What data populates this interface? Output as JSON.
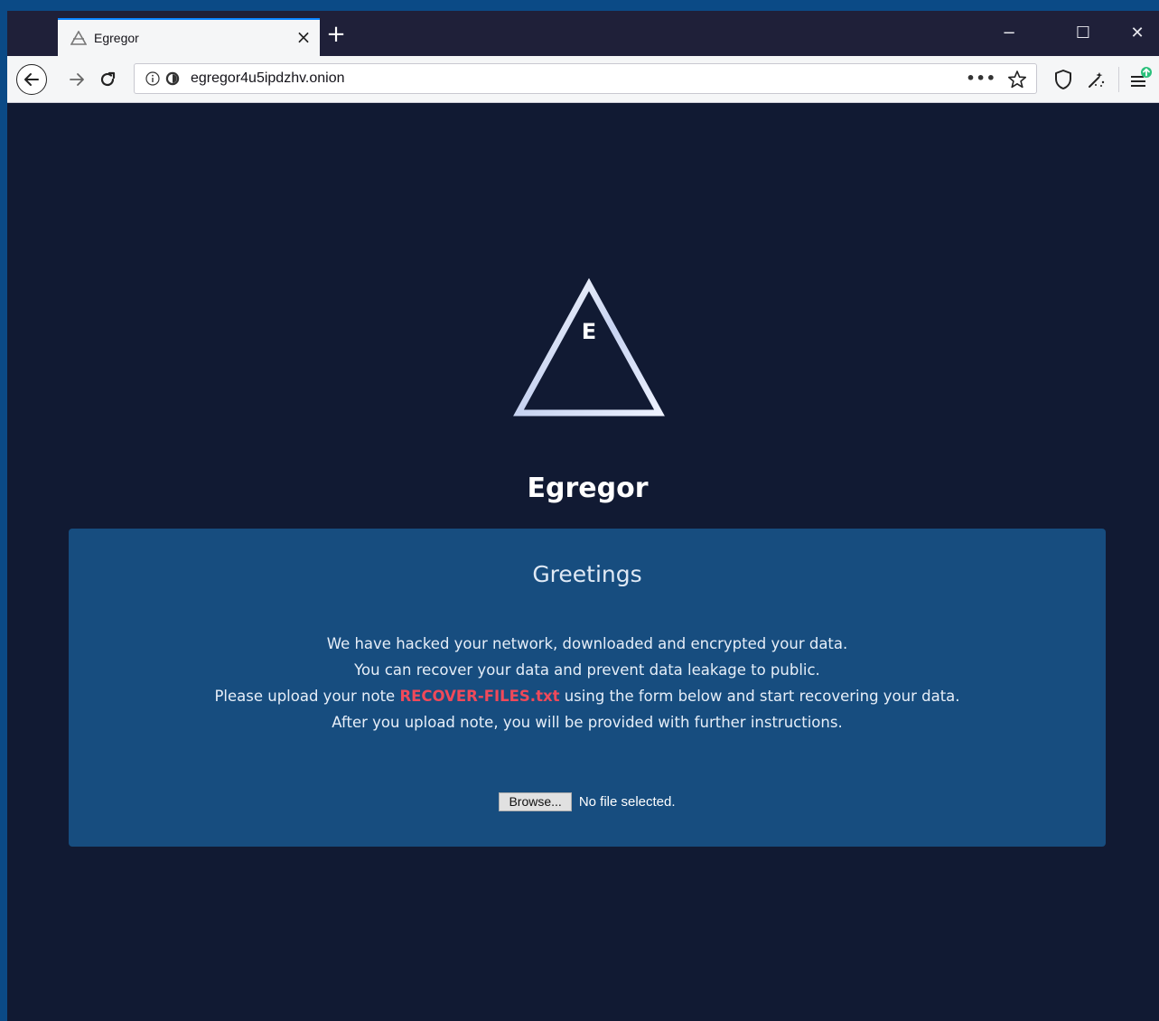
{
  "browser": {
    "tab_title": "Egregor",
    "tab_close": "×",
    "new_tab": "+",
    "url": "egregor4u5ipdzhv.onion",
    "url_more": "•••",
    "window_controls": {
      "minimize": "−",
      "maximize": "☐",
      "close": "✕"
    },
    "icons": [
      "egregor-favicon",
      "back-arrow-icon",
      "forward-arrow-icon",
      "reload-icon",
      "info-icon",
      "onion-icon",
      "star-icon",
      "shield-icon",
      "magic-wand-icon",
      "menu-update-icon"
    ]
  },
  "page": {
    "logo_letter": "E",
    "brand": "Egregor",
    "panel": {
      "title": "Greetings",
      "line1": "We have hacked your network, downloaded and encrypted your data.",
      "line2": "You can recover your data and prevent data leakage to public.",
      "line3_before": "Please upload your note ",
      "line3_link": "RECOVER-FILES.txt",
      "line3_after": " using the form below and start recovering your data.",
      "line4": "After you upload note, you will be provided with further instructions.",
      "browse_label": "Browse...",
      "file_status": "No file selected."
    }
  },
  "colors": {
    "background": "#111a33",
    "panel": "#174d7f",
    "accent_link": "#f0495a",
    "tab_accent": "#0a84ff"
  }
}
